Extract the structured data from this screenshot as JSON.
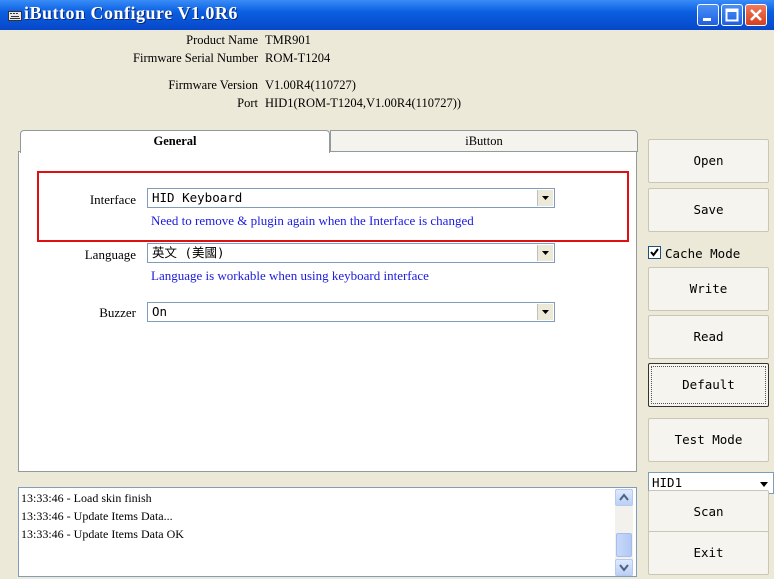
{
  "window": {
    "title": "iButton Configure V1.0R6",
    "icons": [
      "keyboard-icon",
      "minimize-icon",
      "maximize-icon",
      "close-icon"
    ]
  },
  "info": {
    "product_name_label": "Product Name",
    "product_name": "TMR901",
    "serial_label": "Firmware Serial Number",
    "serial": "ROM-T1204",
    "version_label": "Firmware Version",
    "version": "V1.00R4(110727)",
    "port_label": "Port",
    "port": "HID1(ROM-T1204,V1.00R4(110727))"
  },
  "tabs": [
    {
      "label": "General",
      "active": true
    },
    {
      "label": "iButton",
      "active": false
    }
  ],
  "general": {
    "interface_label": "Interface",
    "interface_value": "HID Keyboard",
    "interface_hint": "Need to remove & plugin again when the Interface is changed",
    "language_label": "Language",
    "language_value": "英文 (美國)",
    "language_hint": "Language is workable when using keyboard interface",
    "buzzer_label": "Buzzer",
    "buzzer_value": "On"
  },
  "buttons": {
    "open": "Open",
    "save": "Save",
    "cache_mode": "Cache Mode",
    "cache_mode_checked": true,
    "write": "Write",
    "read": "Read",
    "default": "Default",
    "test_mode": "Test Mode",
    "port_select": "HID1",
    "scan": "Scan",
    "exit": "Exit"
  },
  "log": [
    "13:33:46 - Load skin finish",
    "13:33:46 - Update Items Data...",
    "13:33:46 - Update Items Data OK"
  ],
  "colors": {
    "hint_text": "#1a1ae0",
    "highlight_box": "#e01010",
    "titlebar": "#0a5fe0"
  }
}
